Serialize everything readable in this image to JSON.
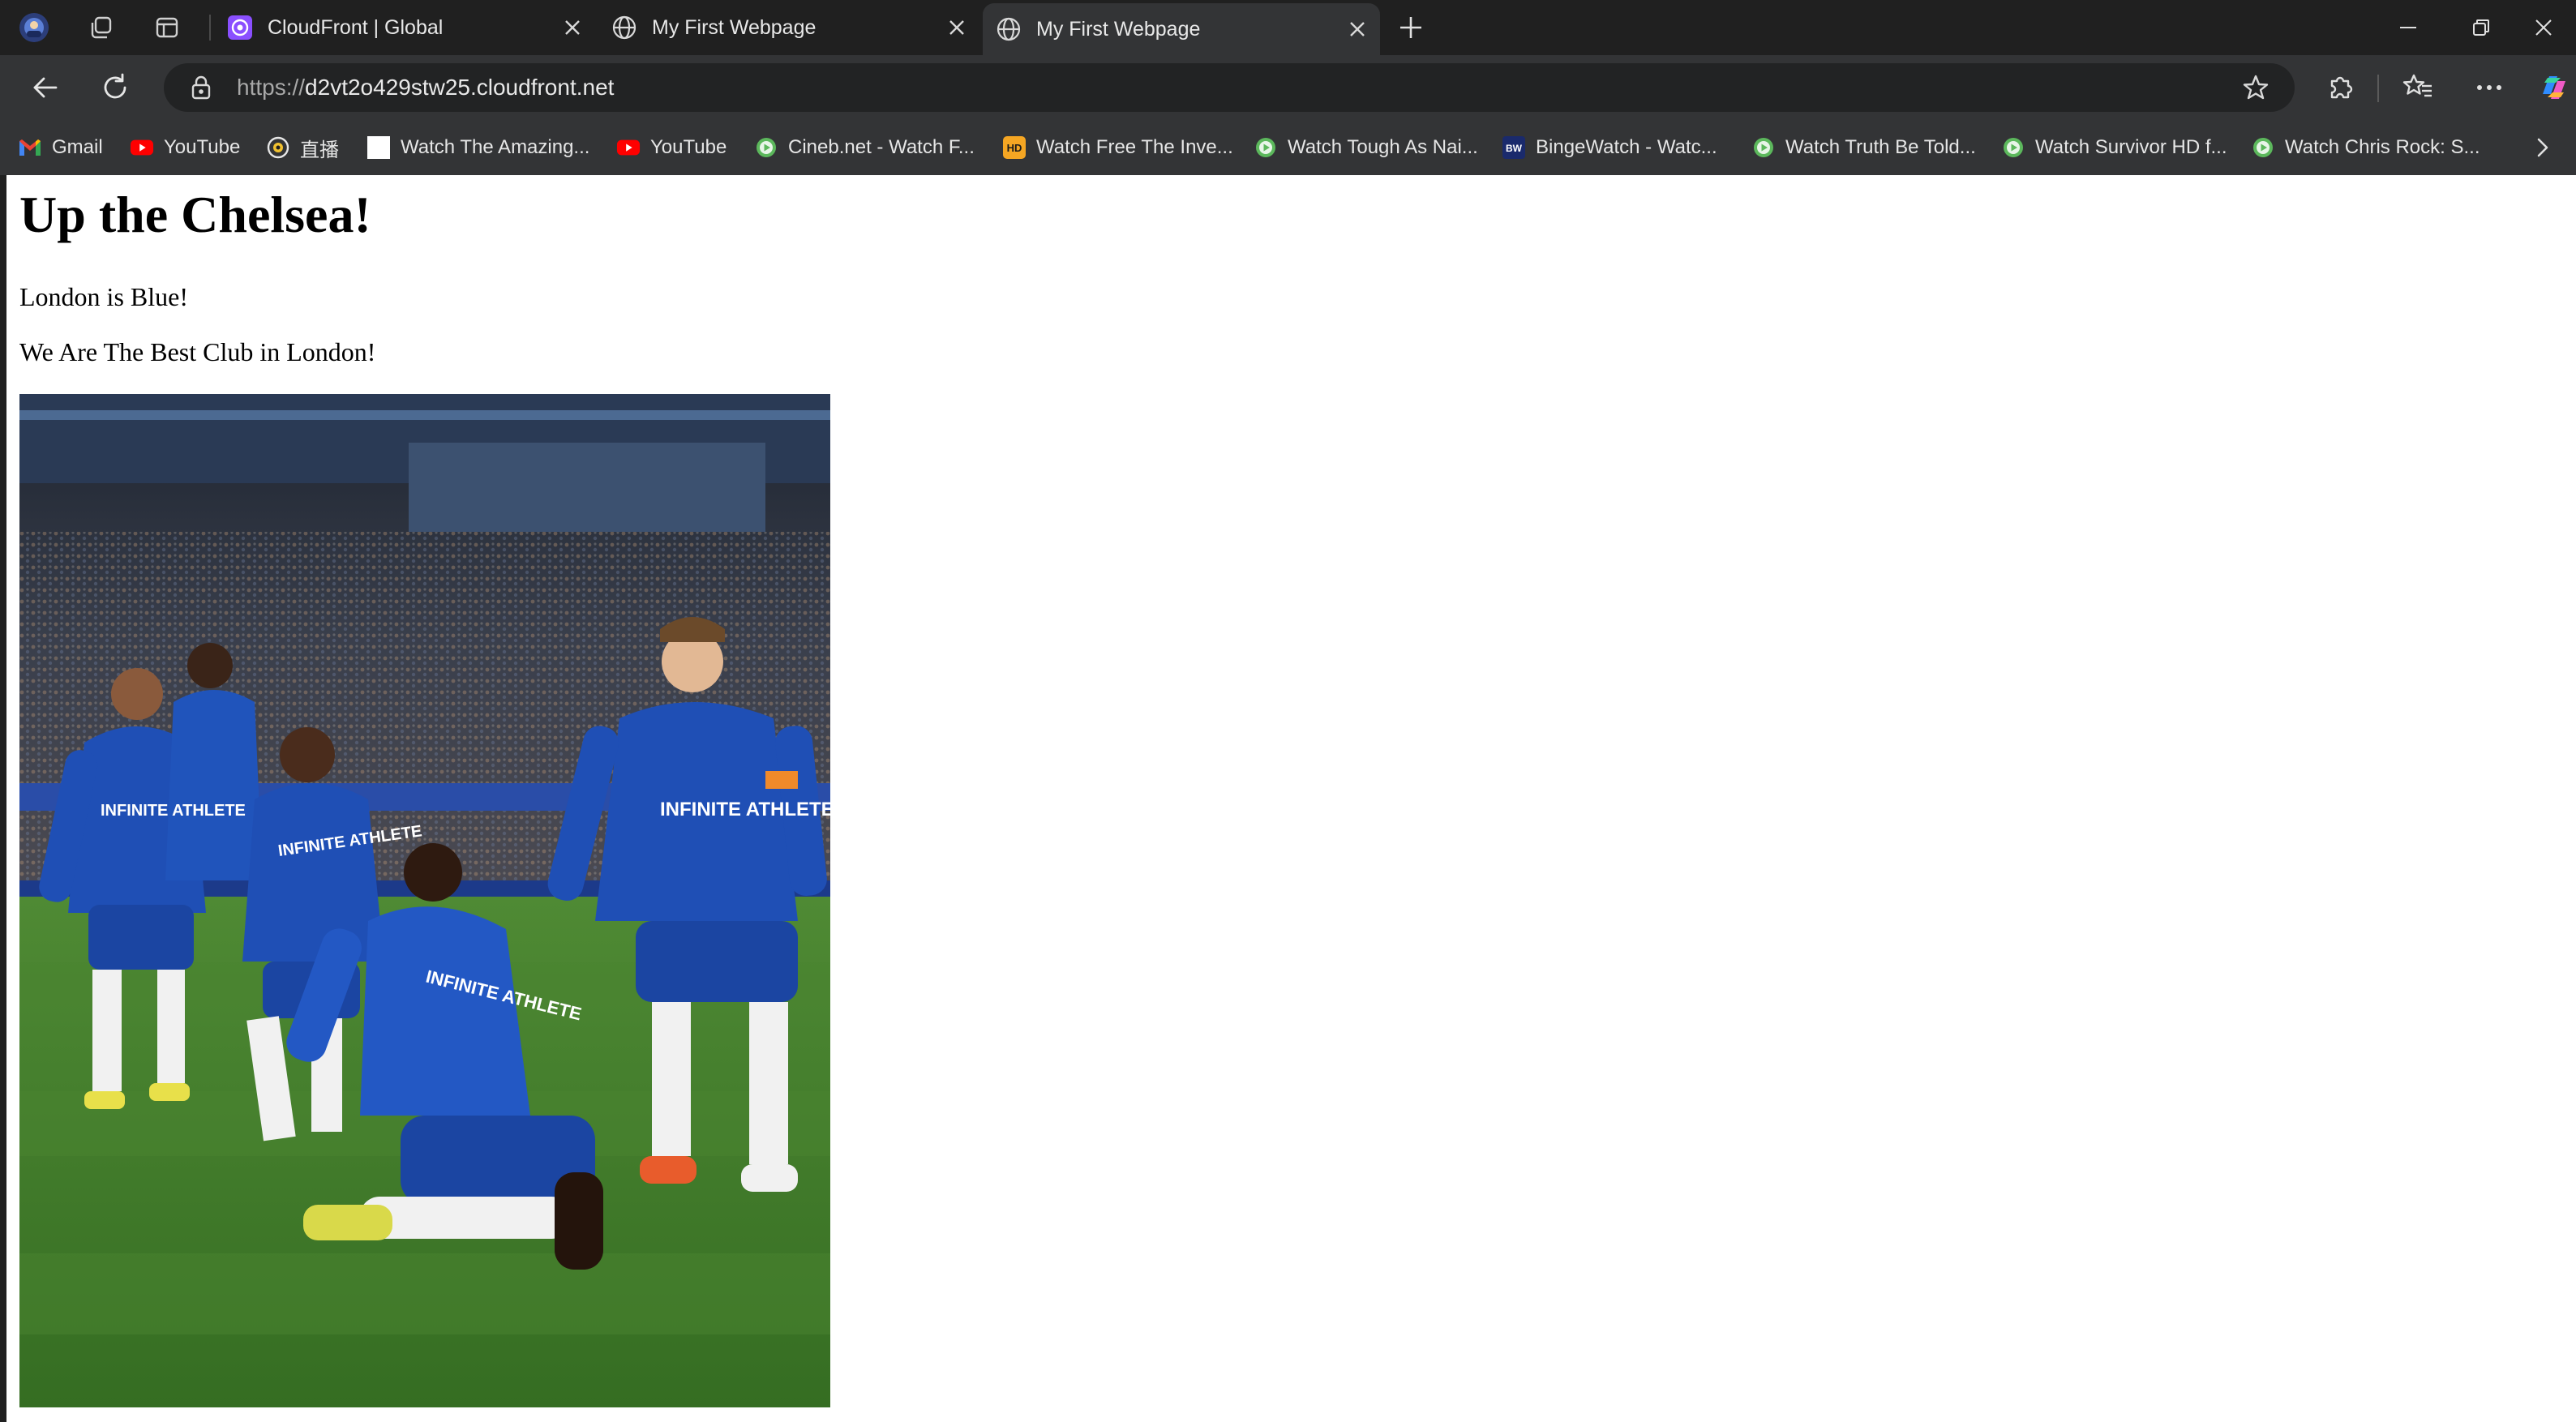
{
  "browser": {
    "tabs": [
      {
        "label": "CloudFront | Global",
        "icon": "cloudfront-icon",
        "active": false
      },
      {
        "label": "My First Webpage",
        "icon": "globe-icon",
        "active": false
      },
      {
        "label": "My First Webpage",
        "icon": "globe-icon",
        "active": true
      }
    ],
    "address": {
      "scheme": "https://",
      "host": "d2vt2o429stw25.cloudfront.net"
    },
    "bookmarks": [
      {
        "label": "Gmail",
        "icon": "gmail-icon"
      },
      {
        "label": "YouTube",
        "icon": "youtube-icon"
      },
      {
        "label": "直播",
        "icon": "live-icon"
      },
      {
        "label": "Watch The Amazing...",
        "icon": "blank-page-icon"
      },
      {
        "label": "YouTube",
        "icon": "youtube-icon"
      },
      {
        "label": "Cineb.net - Watch F...",
        "icon": "play-circle-icon"
      },
      {
        "label": "Watch Free The Inve...",
        "icon": "hd-icon"
      },
      {
        "label": "Watch Tough As Nai...",
        "icon": "play-circle-icon"
      },
      {
        "label": "BingeWatch - Watc...",
        "icon": "bw-icon"
      },
      {
        "label": "Watch Truth Be Told...",
        "icon": "play-circle-icon"
      },
      {
        "label": "Watch Survivor HD f...",
        "icon": "play-circle-icon"
      },
      {
        "label": "Watch Chris Rock: S...",
        "icon": "play-circle-icon"
      }
    ],
    "colors": {
      "chrome_dark": "#202020",
      "toolbar": "#333436",
      "youtube_red": "#ff0000",
      "play_green": "#5cb85c",
      "cloudfront_purple": "#8a4fff",
      "chelsea_blue": "#1f4fb5",
      "pitch_green": "#3f7d2a"
    }
  },
  "page": {
    "heading": "Up the Chelsea!",
    "paragraphs": [
      "London is Blue!",
      "We Are The Best Club in London!"
    ],
    "image_subject": "chelsea-players-celebrating-photo",
    "shirt_sponsor": "INFINITE ATHLETE"
  }
}
